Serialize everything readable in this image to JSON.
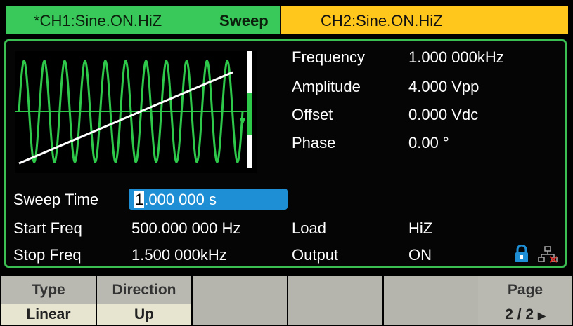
{
  "header": {
    "ch1_label": "*CH1:Sine.ON.HiZ",
    "mode_label": "Sweep",
    "ch2_label": "CH2:Sine.ON.HiZ"
  },
  "params": {
    "frequency_label": "Frequency",
    "frequency_value": "1.000 000kHz",
    "amplitude_label": "Amplitude",
    "amplitude_value": "4.000 Vpp",
    "offset_label": "Offset",
    "offset_value": "0.000 Vdc",
    "phase_label": "Phase",
    "phase_value": "0.00 °"
  },
  "sweep": {
    "time_label": "Sweep Time",
    "time_cursor_char": "1",
    "time_value_rest": ".000 000 s",
    "start_label": "Start Freq",
    "start_value": "500.000 000 Hz",
    "stop_label": "Stop Freq",
    "stop_value": "1.500 000kHz"
  },
  "output": {
    "load_label": "Load",
    "load_value": "HiZ",
    "output_label": "Output",
    "output_value": "ON"
  },
  "status_icons": {
    "lock": "lock-icon",
    "network": "network-icon"
  },
  "softkeys": [
    {
      "title": "Type",
      "value": "Linear"
    },
    {
      "title": "Direction",
      "value": "Up"
    },
    {
      "title": "",
      "value": ""
    },
    {
      "title": "",
      "value": ""
    },
    {
      "title": "",
      "value": ""
    },
    {
      "title": "Page",
      "value": "2 / 2"
    }
  ],
  "colors": {
    "ch1_tab": "#38c95a",
    "ch2_tab": "#ffc61c",
    "panel_border": "#3bbf52",
    "selected_field": "#1e8fd5",
    "waveform": "#2ec84a"
  }
}
